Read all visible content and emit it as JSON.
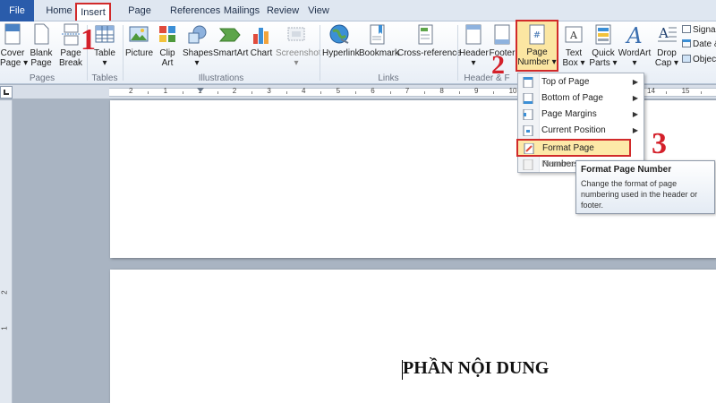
{
  "tabs": [
    {
      "label": "File"
    },
    {
      "label": "Home"
    },
    {
      "label": "Insert"
    },
    {
      "label": "Page Layout"
    },
    {
      "label": "References"
    },
    {
      "label": "Mailings"
    },
    {
      "label": "Review"
    },
    {
      "label": "View"
    }
  ],
  "ribbon": {
    "pages": {
      "group": "Pages",
      "cover": [
        "Cover",
        "Page ▾"
      ],
      "blank": [
        "Blank",
        "Page"
      ],
      "break": [
        "Page",
        "Break"
      ]
    },
    "tables": {
      "group": "Tables",
      "table": [
        "Table",
        "▾"
      ]
    },
    "illustrations": {
      "group": "Illustrations",
      "picture": "Picture",
      "clipart": [
        "Clip",
        "Art"
      ],
      "shapes": [
        "Shapes",
        "▾"
      ],
      "smartart": "SmartArt",
      "chart": "Chart",
      "screenshot": [
        "Screenshot",
        "▾"
      ]
    },
    "links": {
      "group": "Links",
      "hyperlink": "Hyperlink",
      "bookmark": "Bookmark",
      "crossref": "Cross-reference"
    },
    "header_footer": {
      "group": "Header & F",
      "header": [
        "Header",
        "▾"
      ],
      "footer": "Footer",
      "page_number": [
        "Page",
        "Number ▾"
      ]
    },
    "text": {
      "group": "Text",
      "textbox": [
        "Text",
        "Box ▾"
      ],
      "quickparts": [
        "Quick",
        "Parts ▾"
      ],
      "wordart": [
        "WordArt",
        "▾"
      ],
      "dropcap": [
        "Drop",
        "Cap ▾"
      ],
      "signature": "Signa",
      "datetime": "Date &",
      "object": "Objec"
    }
  },
  "ruler_numbers": [
    "2",
    "1",
    "1",
    "2",
    "3",
    "4",
    "5",
    "6",
    "7",
    "8",
    "9",
    "10",
    "11",
    "12",
    "13",
    "14",
    "15"
  ],
  "vruler_numbers": [
    "2",
    "1"
  ],
  "menu": {
    "items": [
      {
        "label": "Top of Page",
        "arrow": "▶"
      },
      {
        "label": "Bottom of Page",
        "arrow": "▶"
      },
      {
        "label": "Page Margins",
        "arrow": "▶"
      },
      {
        "label": "Current Position",
        "arrow": "▶"
      },
      {
        "label": "Format Page Numbers..."
      },
      {
        "label": "Remove P"
      }
    ]
  },
  "tooltip": {
    "title": "Format Page Number",
    "body": "Change the format of page numbering used in the header or footer."
  },
  "steps": [
    "1",
    "2",
    "3"
  ],
  "document": {
    "heading": "PHẦN NỘI DUNG"
  },
  "colors": {
    "highlight_red": "#d12a2a",
    "file_tab": "#2a5cab",
    "menu_highlight": "#fde9a8"
  }
}
